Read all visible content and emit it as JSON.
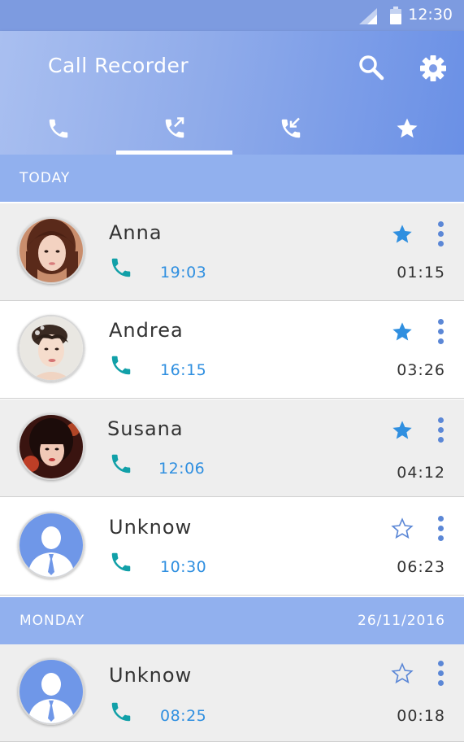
{
  "status_bar": {
    "time": "12:30"
  },
  "app_bar": {
    "title": "Call Recorder"
  },
  "tabs": [
    {
      "icon": "phone-icon"
    },
    {
      "icon": "outgoing-call-icon",
      "selected": true
    },
    {
      "icon": "incoming-call-icon"
    },
    {
      "icon": "star-icon"
    }
  ],
  "sections": [
    {
      "label": "TODAY",
      "date": "",
      "rows": [
        {
          "name": "Anna",
          "time": "19:03",
          "duration": "01:15",
          "starred": true,
          "avatar": "photo"
        },
        {
          "name": "Andrea",
          "time": "16:15",
          "duration": "03:26",
          "starred": true,
          "avatar": "photo"
        },
        {
          "name": "Susana",
          "time": "12:06",
          "duration": "04:12",
          "starred": true,
          "avatar": "photo"
        },
        {
          "name": "Unknow",
          "time": "10:30",
          "duration": "06:23",
          "starred": false,
          "avatar": "default-person"
        }
      ]
    },
    {
      "label": "MONDAY",
      "date": "26/11/2016",
      "rows": [
        {
          "name": "Unknow",
          "time": "08:25",
          "duration": "00:18",
          "starred": false,
          "avatar": "default-person"
        }
      ]
    }
  ],
  "colors": {
    "accent": "#2f8fe0",
    "section_bg": "#91b0ee",
    "call_icon": "#11a0a8",
    "star": "#2f8fe0"
  }
}
